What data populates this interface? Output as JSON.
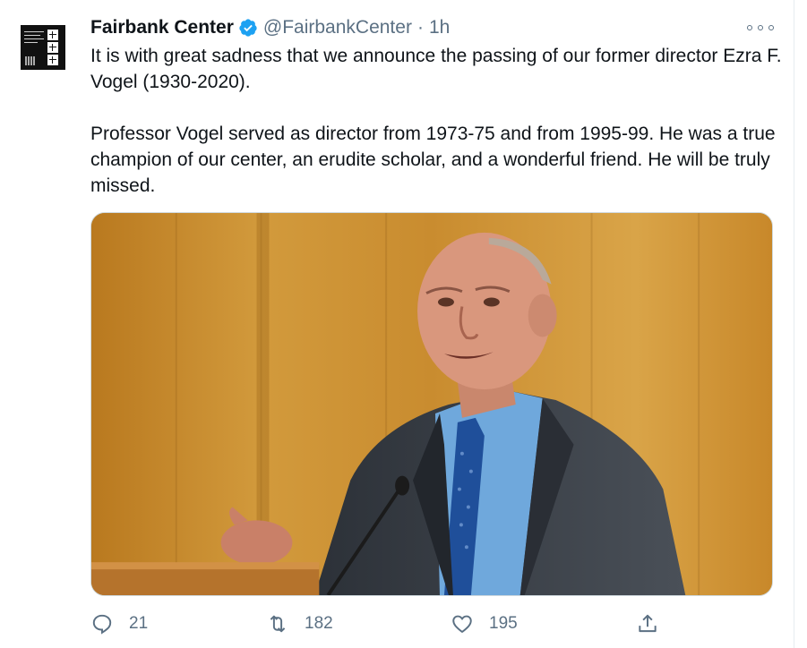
{
  "tweet": {
    "author_name": "Fairbank Center",
    "handle": "@FairbankCenter",
    "separator": "·",
    "time": "1h",
    "paragraphs": [
      "It is with great sadness that we announce the passing of our former director Ezra F. Vogel (1930-2020).",
      "Professor Vogel served as director from 1973-75 and from 1995-99. He was a true champion of our center, an erudite scholar, and a wonderful friend. He will be truly missed."
    ],
    "avatar_icon": "fairbank-center-logo",
    "verified_icon": "verified-badge-icon",
    "more_icon": "more-options-icon"
  },
  "actions": {
    "reply": {
      "icon": "reply-icon",
      "count": "21"
    },
    "retweet": {
      "icon": "retweet-icon",
      "count": "182"
    },
    "like": {
      "icon": "heart-icon",
      "count": "195"
    },
    "share": {
      "icon": "share-icon"
    }
  },
  "colors": {
    "text": "#0f1419",
    "secondary": "#5b7083",
    "verified": "#1da1f2",
    "photo_background": "#c58a2c"
  }
}
